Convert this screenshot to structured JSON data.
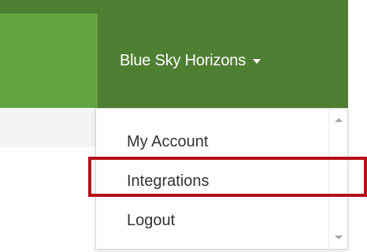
{
  "navbar": {
    "account_name": "Blue Sky Horizons",
    "caret_icon": "caret-down-icon",
    "background_color": "#4f7f33",
    "left_panel_color": "#62a33f"
  },
  "dropdown": {
    "items": [
      {
        "label": "My Account"
      },
      {
        "label": "Integrations"
      },
      {
        "label": "Logout"
      }
    ],
    "highlighted_item": "Integrations",
    "highlight_color": "#b4101a",
    "scroll_icons": [
      "scroll-up-icon",
      "scroll-down-icon"
    ]
  }
}
